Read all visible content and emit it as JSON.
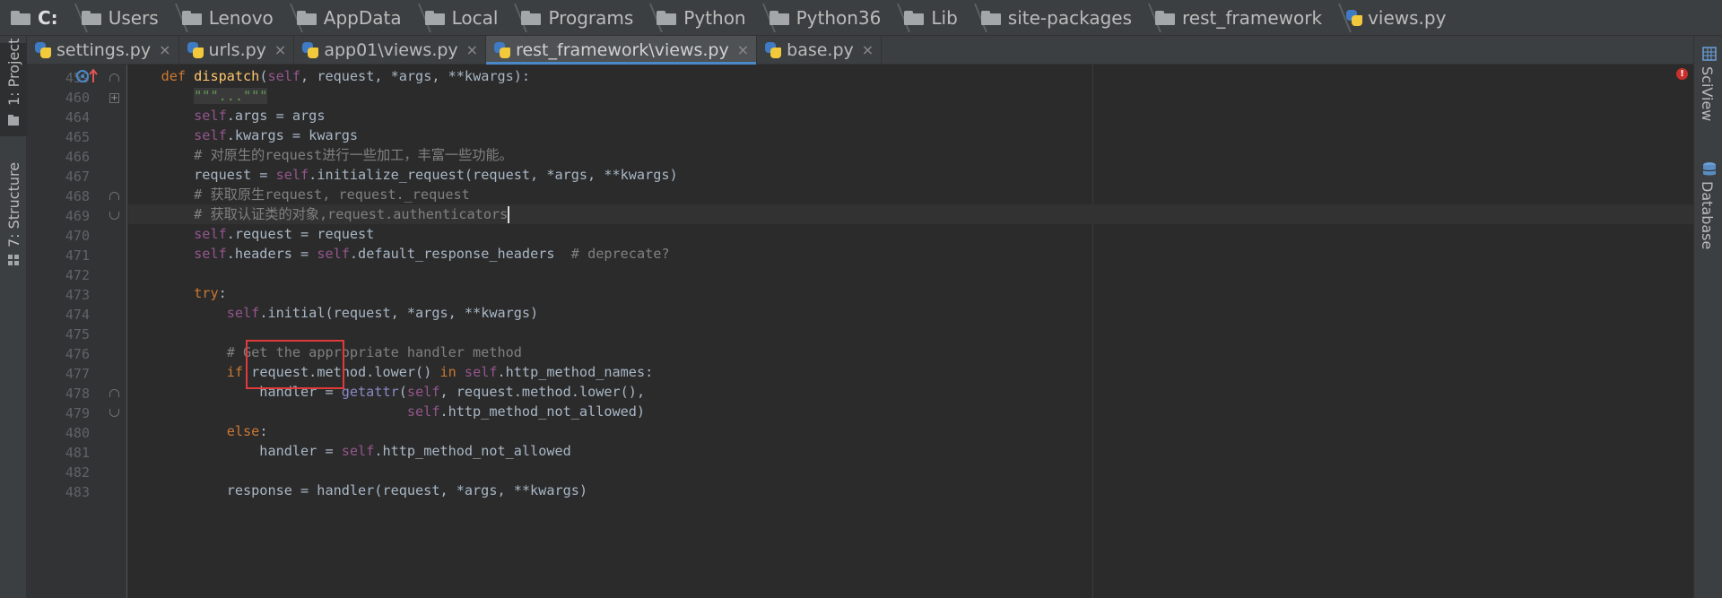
{
  "breadcrumb": [
    {
      "label": "C:",
      "bold": true
    },
    {
      "label": "Users"
    },
    {
      "label": "Lenovo"
    },
    {
      "label": "AppData"
    },
    {
      "label": "Local"
    },
    {
      "label": "Programs"
    },
    {
      "label": "Python"
    },
    {
      "label": "Python36"
    },
    {
      "label": "Lib"
    },
    {
      "label": "site-packages"
    },
    {
      "label": "rest_framework"
    },
    {
      "label": "views.py",
      "python": true
    }
  ],
  "tabs": [
    {
      "label": "settings.py",
      "active": false
    },
    {
      "label": "urls.py",
      "active": false
    },
    {
      "label": "app01\\views.py",
      "active": false
    },
    {
      "label": "rest_framework\\views.py",
      "active": true
    },
    {
      "label": "base.py",
      "active": false
    }
  ],
  "tab_close_glyph": "×",
  "tool_windows": {
    "left_top": "1: Project",
    "left_bottom": "7: Structure",
    "right_top": "SciView",
    "right_bottom": "Database"
  },
  "error_indicator": "!",
  "code": {
    "lines": [
      {
        "num": "459",
        "tokens": [
          [
            "plain",
            "    "
          ],
          [
            "kw",
            "def "
          ],
          [
            "fn",
            "dispatch"
          ],
          [
            "plain",
            "("
          ],
          [
            "self",
            "self"
          ],
          [
            "plain",
            ", request, *args, **kwargs):"
          ]
        ]
      },
      {
        "num": "460",
        "tokens": [
          [
            "plain",
            "        "
          ],
          [
            "doc",
            "\"\"\"...\"\"\""
          ]
        ]
      },
      {
        "num": "464",
        "tokens": [
          [
            "plain",
            "        "
          ],
          [
            "self",
            "self"
          ],
          [
            "plain",
            ".args = args"
          ]
        ]
      },
      {
        "num": "465",
        "tokens": [
          [
            "plain",
            "        "
          ],
          [
            "self",
            "self"
          ],
          [
            "plain",
            ".kwargs = kwargs"
          ]
        ]
      },
      {
        "num": "466",
        "tokens": [
          [
            "plain",
            "        "
          ],
          [
            "cm",
            "# 对原生的request进行一些加工，丰富一些功能。"
          ]
        ]
      },
      {
        "num": "467",
        "tokens": [
          [
            "plain",
            "        request = "
          ],
          [
            "self",
            "self"
          ],
          [
            "plain",
            ".initialize_request(request, *args, **kwargs)"
          ]
        ]
      },
      {
        "num": "468",
        "tokens": [
          [
            "plain",
            "        "
          ],
          [
            "cm",
            "# 获取原生request, request._request"
          ]
        ]
      },
      {
        "num": "469",
        "tokens": [
          [
            "plain",
            "        "
          ],
          [
            "cm",
            "# 获取认证类的对象,request.authenticators"
          ]
        ],
        "current": true,
        "caret": true
      },
      {
        "num": "470",
        "tokens": [
          [
            "plain",
            "        "
          ],
          [
            "self",
            "self"
          ],
          [
            "plain",
            ".request = request"
          ]
        ]
      },
      {
        "num": "471",
        "tokens": [
          [
            "plain",
            "        "
          ],
          [
            "self",
            "self"
          ],
          [
            "plain",
            ".headers = "
          ],
          [
            "self",
            "self"
          ],
          [
            "plain",
            ".default_response_headers  "
          ],
          [
            "cm",
            "# deprecate?"
          ]
        ]
      },
      {
        "num": "472",
        "tokens": []
      },
      {
        "num": "473",
        "tokens": [
          [
            "plain",
            "        "
          ],
          [
            "kw",
            "try"
          ],
          [
            "plain",
            ":"
          ]
        ]
      },
      {
        "num": "474",
        "tokens": [
          [
            "plain",
            "            "
          ],
          [
            "self",
            "self"
          ],
          [
            "plain",
            ".initial(request, *args, **kwargs)"
          ]
        ]
      },
      {
        "num": "475",
        "tokens": []
      },
      {
        "num": "476",
        "tokens": [
          [
            "plain",
            "            "
          ],
          [
            "cm",
            "# Get the appropriate handler method"
          ]
        ]
      },
      {
        "num": "477",
        "tokens": [
          [
            "plain",
            "            "
          ],
          [
            "kw",
            "if "
          ],
          [
            "plain",
            "request.method.lower() "
          ],
          [
            "kw",
            "in "
          ],
          [
            "self",
            "self"
          ],
          [
            "plain",
            ".http_method_names:"
          ]
        ]
      },
      {
        "num": "478",
        "tokens": [
          [
            "plain",
            "                handler = "
          ],
          [
            "bi",
            "getattr"
          ],
          [
            "plain",
            "("
          ],
          [
            "self",
            "self"
          ],
          [
            "plain",
            ", request.method.lower(),"
          ]
        ]
      },
      {
        "num": "479",
        "tokens": [
          [
            "plain",
            "                                  "
          ],
          [
            "self",
            "self"
          ],
          [
            "plain",
            ".http_method_not_allowed)"
          ]
        ]
      },
      {
        "num": "480",
        "tokens": [
          [
            "plain",
            "            "
          ],
          [
            "kw",
            "else"
          ],
          [
            "plain",
            ":"
          ]
        ]
      },
      {
        "num": "481",
        "tokens": [
          [
            "plain",
            "                handler = "
          ],
          [
            "self",
            "self"
          ],
          [
            "plain",
            ".http_method_not_allowed"
          ]
        ]
      },
      {
        "num": "482",
        "tokens": []
      },
      {
        "num": "483",
        "tokens": [
          [
            "plain",
            "            response = handler(request, *args, **kwargs)"
          ]
        ]
      }
    ]
  }
}
